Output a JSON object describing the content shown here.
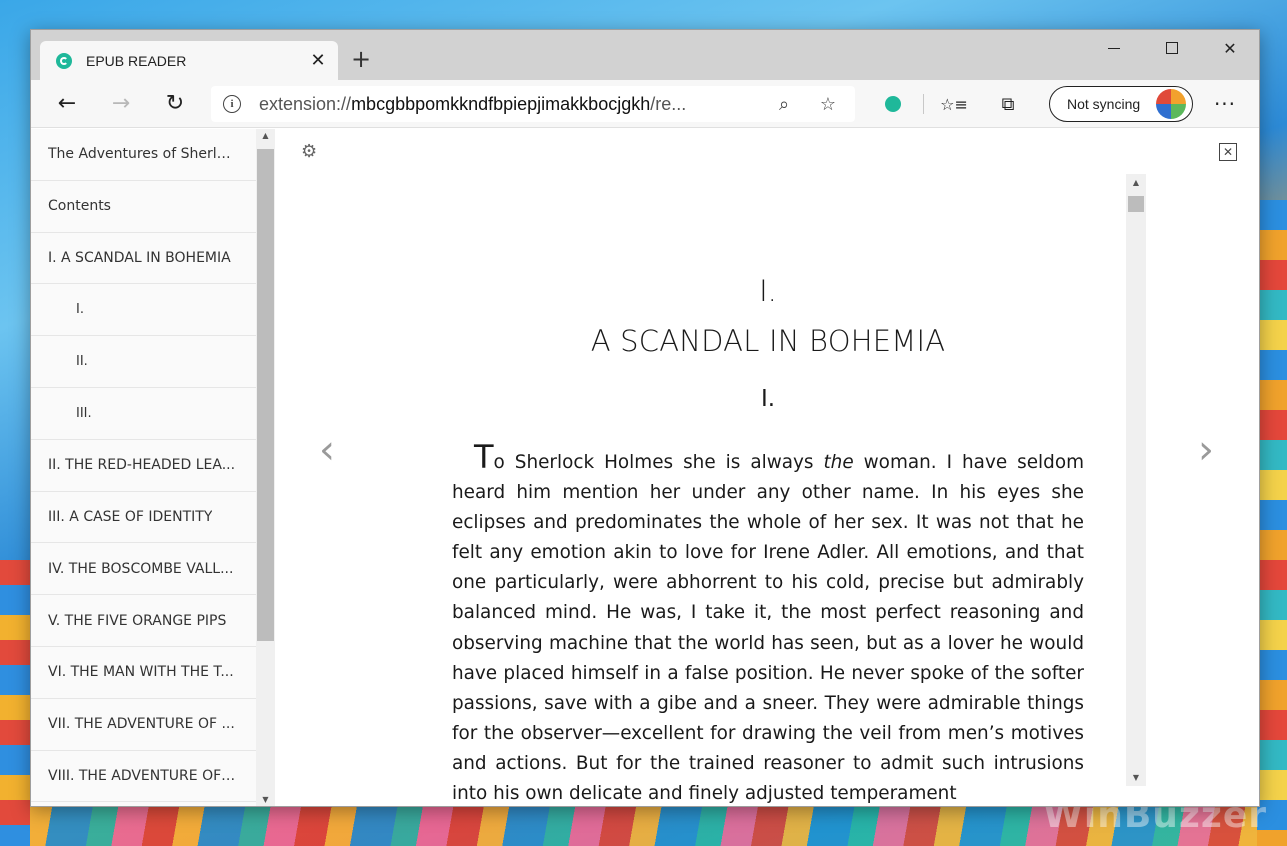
{
  "tab": {
    "title": "EPUB READER",
    "close": "✕",
    "new_tab": "+"
  },
  "window_controls": {
    "close": "✕"
  },
  "toolbar": {
    "back": "←",
    "forward": "→",
    "refresh": "↻",
    "address_scheme": "extension://",
    "address_host": "mbcgbbpomkkndfbpiepjimakkbocjgkh",
    "address_path": "/re...",
    "zoom_icon": "⌕",
    "favorite_icon": "☆",
    "favorites_icon": "☆≡",
    "collections_icon": "⧉",
    "sync_label": "Not syncing",
    "more": "···"
  },
  "sidebar": {
    "items": [
      {
        "label": "The Adventures of Sherlo...",
        "level": 0
      },
      {
        "label": "Contents",
        "level": 0
      },
      {
        "label": "I. A SCANDAL IN BOHEMIA",
        "level": 0
      },
      {
        "label": "I.",
        "level": 1
      },
      {
        "label": "II.",
        "level": 1
      },
      {
        "label": "III.",
        "level": 1
      },
      {
        "label": "II. THE RED-HEADED LEA...",
        "level": 0
      },
      {
        "label": "III. A CASE OF IDENTITY",
        "level": 0
      },
      {
        "label": "IV. THE BOSCOMBE VALL...",
        "level": 0
      },
      {
        "label": "V. THE FIVE ORANGE PIPS",
        "level": 0
      },
      {
        "label": "VI. THE MAN WITH THE T...",
        "level": 0
      },
      {
        "label": "VII. THE ADVENTURE OF ...",
        "level": 0
      },
      {
        "label": "VIII. THE ADVENTURE OF ...",
        "level": 0
      }
    ]
  },
  "reader": {
    "settings_icon": "⚙",
    "close_icon": "✕",
    "prev": "‹",
    "next": "›",
    "chapter_num": "I.",
    "chapter_title": "A SCANDAL IN BOHEMIA",
    "section": "I.",
    "dropcap": "T",
    "para_start": "o Sherlock Holmes she is always ",
    "para_em": "the",
    "para_rest": " woman. I have seldom heard him mention her under any other name. In his eyes she eclipses and predominates the whole of her sex. It was not that he felt any emotion akin to love for Irene Adler. All emotions, and that one particularly, were abhorrent to his cold, precise but admirably balanced mind. He was, I take it, the most perfect reasoning and observing machine that the world has seen, but as a lover he would have placed himself in a false position. He never spoke of the softer passions, save with a gibe and a sneer. They were admirable things for the observer—excellent for drawing the veil from men’s motives and actions. But for the trained reasoner to admit such intrusions into his own delicate and finely adjusted temperament"
  },
  "watermark": "WinBuzzer",
  "colors": {
    "accent": "#1fb89a",
    "tab_bar": "#d2d2d2",
    "toolbar": "#f7f7f7"
  }
}
